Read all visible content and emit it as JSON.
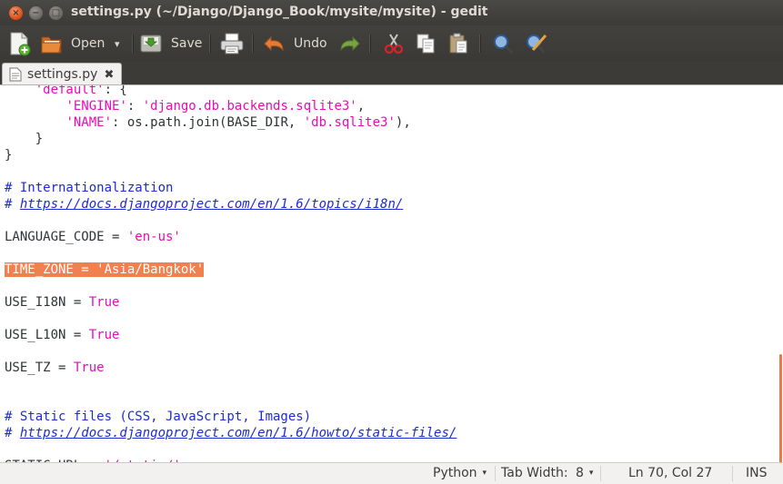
{
  "window": {
    "title": "settings.py (~/Django/Django_Book/mysite/mysite) - gedit",
    "buttons": {
      "close": "×",
      "minimize": "−",
      "maximize": "□"
    }
  },
  "toolbar": {
    "new_icon": "new-document-icon",
    "open_label": "Open",
    "open_dropdown": "▾",
    "save_label": "Save",
    "print_icon": "print-icon",
    "undo_label": "Undo",
    "redo_icon": "redo-icon",
    "cut_icon": "cut-icon",
    "copy_icon": "copy-icon",
    "paste_icon": "paste-icon",
    "find_icon": "search-icon",
    "replace_icon": "find-replace-icon"
  },
  "tabs": [
    {
      "label": "settings.py",
      "close": "✖"
    }
  ],
  "editor": {
    "lines": [
      [
        {
          "t": "    ",
          "c": ""
        },
        {
          "t": "'default'",
          "c": "str"
        },
        {
          "t": ": {",
          "c": ""
        }
      ],
      [
        {
          "t": "        ",
          "c": ""
        },
        {
          "t": "'ENGINE'",
          "c": "str"
        },
        {
          "t": ": ",
          "c": ""
        },
        {
          "t": "'django.db.backends.sqlite3'",
          "c": "str"
        },
        {
          "t": ",",
          "c": ""
        }
      ],
      [
        {
          "t": "        ",
          "c": ""
        },
        {
          "t": "'NAME'",
          "c": "str"
        },
        {
          "t": ": os.path.join(BASE_DIR, ",
          "c": ""
        },
        {
          "t": "'db.sqlite3'",
          "c": "str"
        },
        {
          "t": "),",
          "c": ""
        }
      ],
      [
        {
          "t": "    }",
          "c": ""
        }
      ],
      [
        {
          "t": "}",
          "c": ""
        }
      ],
      [],
      [
        {
          "t": "# Internationalization",
          "c": "cmt"
        }
      ],
      [
        {
          "t": "# ",
          "c": "cmt"
        },
        {
          "t": "https://docs.djangoproject.com/en/1.6/topics/i18n/",
          "c": "url"
        }
      ],
      [],
      [
        {
          "t": "LANGUAGE_CODE = ",
          "c": ""
        },
        {
          "t": "'en-us'",
          "c": "str"
        }
      ],
      [],
      [
        {
          "t": "TIME_ZONE = 'Asia/Bangkok'",
          "c": "sel"
        }
      ],
      [],
      [
        {
          "t": "USE_I18N = ",
          "c": ""
        },
        {
          "t": "True",
          "c": "kw"
        }
      ],
      [],
      [
        {
          "t": "USE_L10N = ",
          "c": ""
        },
        {
          "t": "True",
          "c": "kw"
        }
      ],
      [],
      [
        {
          "t": "USE_TZ = ",
          "c": ""
        },
        {
          "t": "True",
          "c": "kw"
        }
      ],
      [],
      [],
      [
        {
          "t": "# Static files (CSS, JavaScript, Images)",
          "c": "cmt"
        }
      ],
      [
        {
          "t": "# ",
          "c": "cmt"
        },
        {
          "t": "https://docs.djangoproject.com/en/1.6/howto/static-files/",
          "c": "url"
        }
      ],
      [],
      [
        {
          "t": "STATIC_URL = ",
          "c": ""
        },
        {
          "t": "'/static/'",
          "c": "str"
        }
      ]
    ]
  },
  "statusbar": {
    "language": "Python",
    "tab_width_label": "Tab Width:",
    "tab_width_value": "8",
    "dropdown": "▾",
    "position": "Ln 70, Col 27",
    "mode": "INS"
  },
  "colors": {
    "accent": "#f07746",
    "string": "#ea0bb5",
    "comment": "#1d2bd1",
    "selection": "#f08050"
  }
}
